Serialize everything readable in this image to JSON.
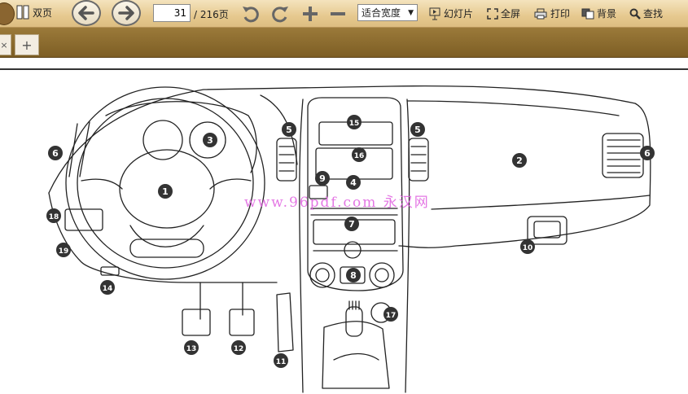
{
  "toolbar": {
    "double_page_label": "双页",
    "page_current": "31",
    "page_total": "/ 216页",
    "zoom_mode": "适合宽度",
    "slideshow_label": "幻灯片",
    "fullscreen_label": "全屏",
    "print_label": "打印",
    "background_label": "背景",
    "find_label": "查找"
  },
  "tabs": {
    "add_label": "+"
  },
  "figure": {
    "watermark": "www.96pdf.com 永汉网",
    "callouts": [
      "1",
      "2",
      "3",
      "4",
      "5",
      "5",
      "6",
      "6",
      "7",
      "8",
      "9",
      "10",
      "11",
      "12",
      "13",
      "14",
      "15",
      "16",
      "17",
      "18",
      "19"
    ]
  }
}
